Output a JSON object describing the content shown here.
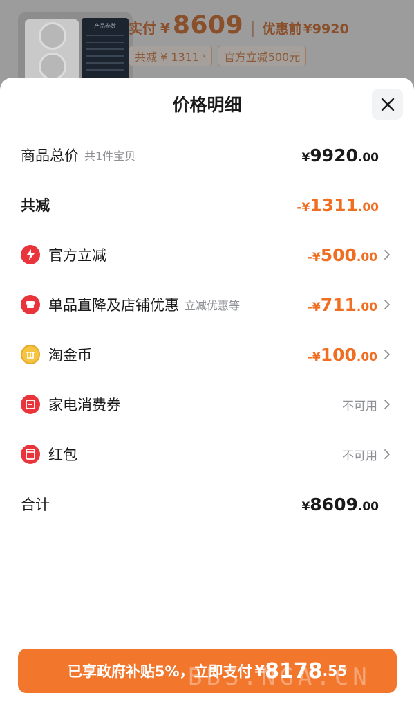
{
  "header": {
    "paid_label": "实付",
    "paid_yen": "¥",
    "paid_amount": "8609",
    "separator": "|",
    "orig_label": "优惠前",
    "orig_amount": "¥9920",
    "chip_total_discount": "共减 ¥ 1311",
    "chip_official": "官方立减500元",
    "spec_title": "产品参数"
  },
  "sheet": {
    "title": "价格明细"
  },
  "rows": [
    {
      "label": "商品总价",
      "sub": "共1件宝贝",
      "sym": "¥",
      "int": "9920",
      "dec": ".00"
    },
    {
      "label": "共减",
      "sym": "-¥",
      "int": "1311",
      "dec": ".00"
    },
    {
      "label": "官方立减",
      "sym": "-¥",
      "int": "500",
      "dec": ".00",
      "icon": "lightning-icon"
    },
    {
      "label": "单品直降及店铺优惠",
      "sub": "立减优惠等",
      "sym": "-¥",
      "int": "711",
      "dec": ".00",
      "icon": "shop-icon"
    },
    {
      "label": "淘金币",
      "sym": "-¥",
      "int": "100",
      "dec": ".00",
      "icon": "coin-icon"
    },
    {
      "label": "家电消费券",
      "status": "不可用",
      "icon": "coupon-icon"
    },
    {
      "label": "红包",
      "status": "不可用",
      "icon": "red-packet-icon"
    },
    {
      "label": "合计",
      "sym": "¥",
      "int": "8609",
      "dec": ".00"
    }
  ],
  "pay": {
    "text": "已享政府补贴5%，立即支付",
    "sym": "¥",
    "int": "8178",
    "dec": ".55"
  },
  "watermark": "BBS.NGA.CN",
  "colors": {
    "accent": "#f06e22",
    "pay_button": "#f2772d",
    "icon_red": "#e8343a",
    "icon_gold": "#f5c542",
    "muted": "#8d8f94"
  }
}
